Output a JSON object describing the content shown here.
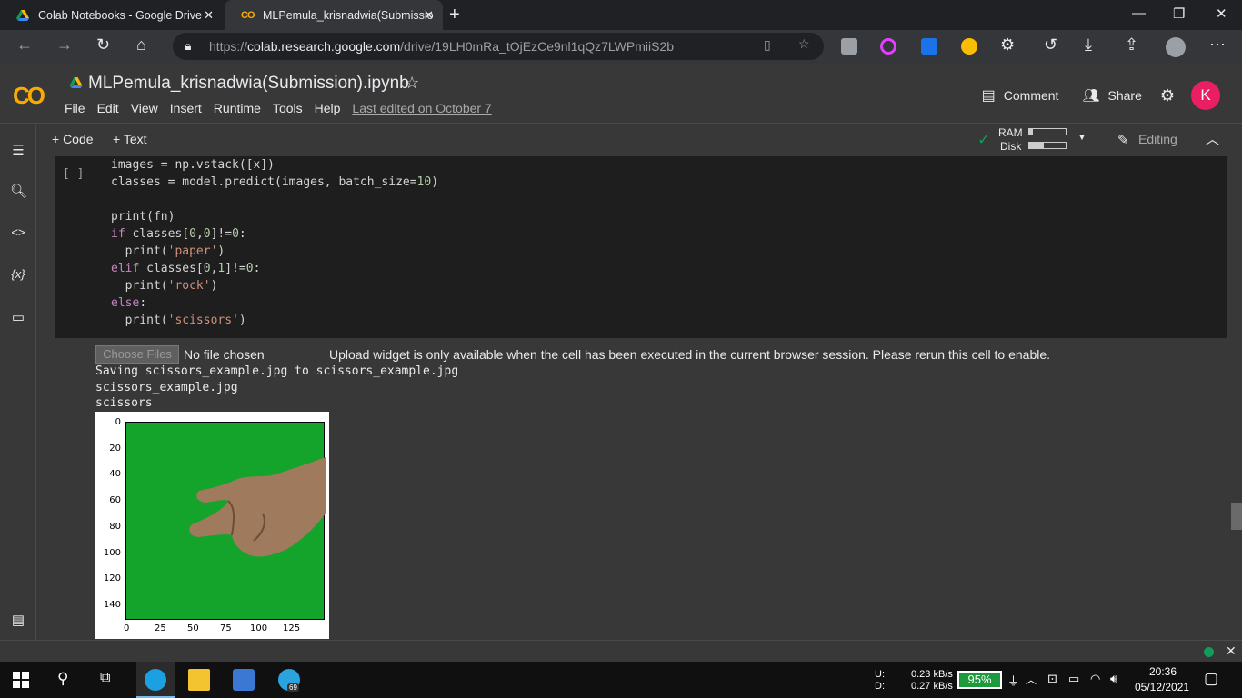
{
  "browser": {
    "tabs": [
      {
        "title": "Colab Notebooks - Google Drive"
      },
      {
        "title": "MLPemula_krisnadwia(Submissio"
      }
    ],
    "url_prefix": "https://",
    "url_host": "colab.research.google.com",
    "url_path": "/drive/19LH0mRa_tOjEzCe9nl1qQz7LWPmiiS2b"
  },
  "colab": {
    "logo": "CO",
    "notebook_title": "MLPemula_krisnadwia(Submission).ipynb",
    "menu": [
      "File",
      "Edit",
      "View",
      "Insert",
      "Runtime",
      "Tools",
      "Help"
    ],
    "last_edited": "Last edited on October 7",
    "comment_label": "Comment",
    "share_label": "Share",
    "avatar_letter": "K",
    "add_code": "+ Code",
    "add_text": "+ Text",
    "ram_label": "RAM",
    "disk_label": "Disk",
    "editing_label": "Editing"
  },
  "cell": {
    "bracket": "[ ]"
  },
  "output": {
    "choose_files": "Choose Files",
    "no_file": "No file chosen",
    "upload_note": "Upload widget is only available when the cell has been executed in the current browser session. Please rerun this cell to enable.",
    "line1": "Saving scissors_example.jpg to scissors_example.jpg",
    "line2": "scissors_example.jpg",
    "line3": "scissors",
    "y_ticks": [
      "0",
      "20",
      "40",
      "60",
      "80",
      "100",
      "120",
      "140"
    ],
    "x_ticks": [
      "0",
      "25",
      "50",
      "75",
      "100",
      "125"
    ]
  },
  "taskbar": {
    "upload_label": "U:",
    "download_label": "D:",
    "upload_speed": "0.23 kB/s",
    "download_speed": "0.27 kB/s",
    "battery": "95%",
    "time": "20:36",
    "date": "05/12/2021",
    "telegram_badge": "69"
  }
}
